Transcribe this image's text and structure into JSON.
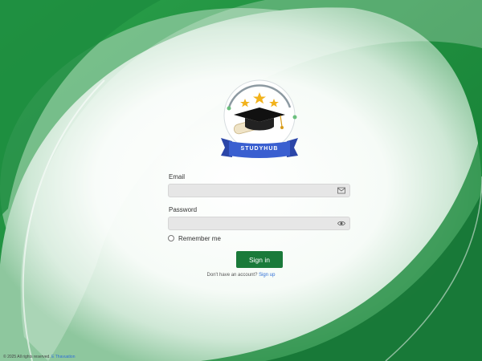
{
  "brand": {
    "name": "STUDYHUB"
  },
  "form": {
    "email_label": "Email",
    "email_value": "",
    "email_placeholder": "",
    "password_label": "Password",
    "password_value": "",
    "password_placeholder": "",
    "remember_label": "Remember me",
    "remember_checked": false,
    "submit_label": "Sign in"
  },
  "signup": {
    "prompt": "Don't have an account?",
    "link_label": "Sign up"
  },
  "footer": {
    "text": "© 2025 All rights reserved.",
    "link_label": "E Thavuation"
  },
  "icons": {
    "email": "envelope-icon",
    "password": "eye-icon",
    "checkbox": "radio-circle-icon"
  },
  "colors": {
    "background_green": "#1f8a3c",
    "button_green": "#1a7a3a",
    "link_blue": "#2f6fd6",
    "input_bg": "#e6e6e6",
    "ribbon_blue": "#3a5fd0",
    "star_gold": "#f2b21b"
  }
}
